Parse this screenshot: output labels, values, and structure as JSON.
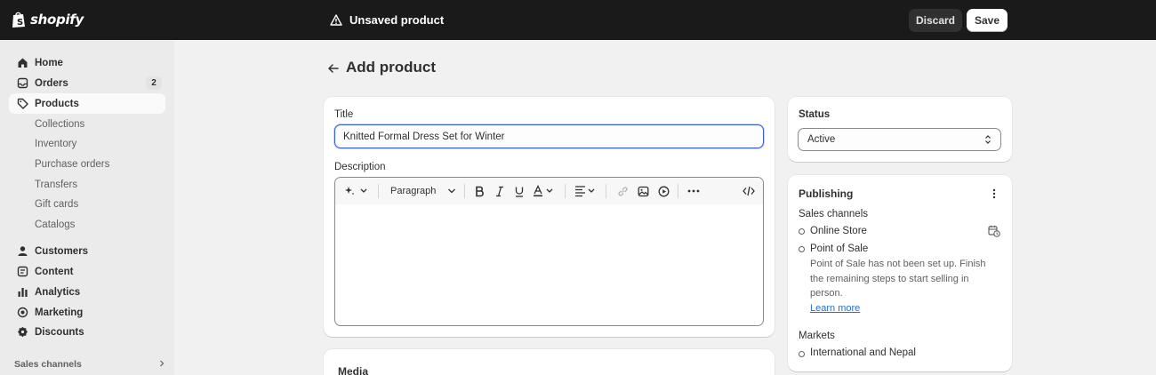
{
  "topbar": {
    "logo_text": "shopify",
    "unsaved_label": "Unsaved product",
    "discard_label": "Discard",
    "save_label": "Save"
  },
  "sidebar": {
    "items": [
      {
        "label": "Home",
        "icon": "home-icon"
      },
      {
        "label": "Orders",
        "icon": "orders-icon",
        "badge": "2"
      },
      {
        "label": "Products",
        "icon": "tag-icon",
        "active": true
      },
      {
        "label": "Collections"
      },
      {
        "label": "Inventory"
      },
      {
        "label": "Purchase orders"
      },
      {
        "label": "Transfers"
      },
      {
        "label": "Gift cards"
      },
      {
        "label": "Catalogs"
      },
      {
        "label": "Customers",
        "icon": "person-icon"
      },
      {
        "label": "Content",
        "icon": "content-icon"
      },
      {
        "label": "Analytics",
        "icon": "bar-chart-icon"
      },
      {
        "label": "Marketing",
        "icon": "target-icon"
      },
      {
        "label": "Discounts",
        "icon": "discount-icon"
      }
    ],
    "sales_channels_label": "Sales channels"
  },
  "page": {
    "title": "Add product"
  },
  "product_form": {
    "title_label": "Title",
    "title_value": "Knitted Formal Dress Set for Winter",
    "description_label": "Description",
    "editor_toolbar": {
      "paragraph_label": "Paragraph"
    },
    "media_title": "Media"
  },
  "status_card": {
    "label": "Status",
    "selected": "Active"
  },
  "publishing_card": {
    "title": "Publishing",
    "sales_channels_label": "Sales channels",
    "channels": [
      "Online Store",
      "Point of Sale"
    ],
    "pos_note": "Point of Sale has not been set up. Finish the remaining steps to start selling in person.",
    "learn_more": "Learn more",
    "markets_label": "Markets",
    "markets_value": "International and Nepal"
  },
  "colors": {
    "topbar": "#1a1a1a",
    "sidebar": "#ebebeb",
    "page_bg": "#f1f1f1",
    "focus_border": "#3b5ccc",
    "link": "#2c6ecb"
  }
}
